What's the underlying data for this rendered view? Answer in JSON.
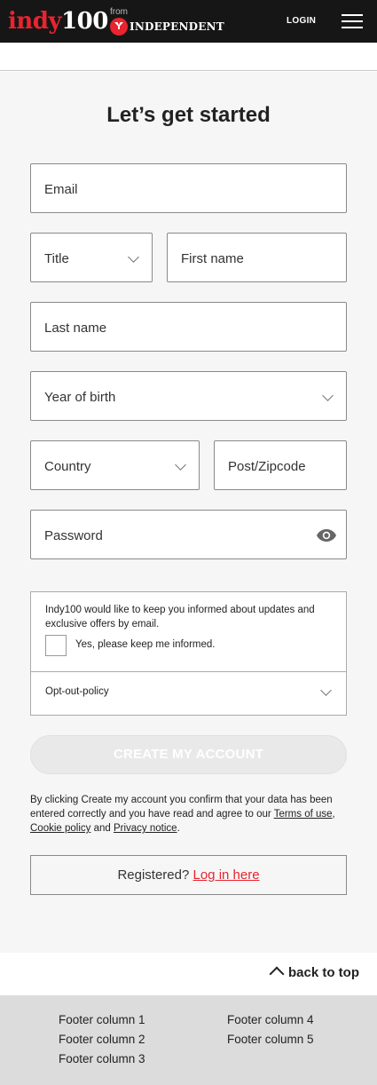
{
  "header": {
    "logo_red": "indy",
    "logo_white": "100",
    "from_text": "from",
    "partner_name": "INDEPENDENT",
    "login_label": "LOGIN",
    "menu_icon": "hamburger-menu-icon"
  },
  "form": {
    "heading": "Let’s get started",
    "email_label": "Email",
    "title_label": "Title",
    "first_name_label": "First name",
    "last_name_label": "Last name",
    "year_of_birth_label": "Year of birth",
    "country_label": "Country",
    "postcode_label": "Post/Zipcode",
    "password_label": "Password",
    "password_icon": "eye-icon"
  },
  "consent": {
    "text": "Indy100 would like to keep you informed about updates and exclusive offers by email.",
    "checkbox_label": "Yes, please keep me informed.",
    "opt_out_label": "Opt-out-policy"
  },
  "create_button": "CREATE MY ACCOUNT",
  "legal": {
    "prefix": "By clicking Create my account you confirm that your data has been entered correctly and you have read and agree to our ",
    "terms": "Terms of use",
    "comma": ", ",
    "cookie": "Cookie policy",
    "and": " and ",
    "privacy": "Privacy notice",
    "suffix": "."
  },
  "registered": {
    "prefix": "Registered? ",
    "link": "Log in here"
  },
  "back_to_top": "back to top",
  "footer": {
    "columns": [
      "Footer column 1",
      "Footer column 2",
      "Footer column 3",
      "Footer column 4",
      "Footer column 5"
    ]
  },
  "colors": {
    "brand_red": "#e8242f",
    "header_bg": "#161616",
    "page_bg": "#f6f6f6",
    "footer_bg": "#dcdcdc"
  }
}
